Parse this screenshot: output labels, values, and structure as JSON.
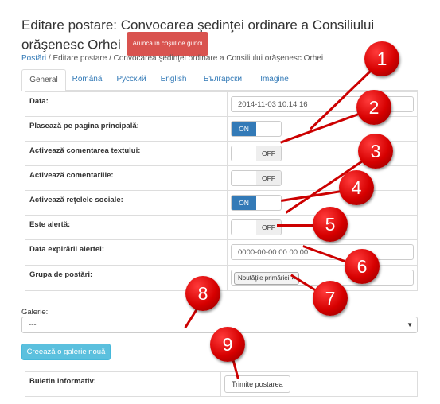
{
  "header": {
    "title": "Editare postare: Convocarea şedinţei ordinare a Consiliului orăşenesc Orhei",
    "trash_button": "Aruncă în coşul de gunoi"
  },
  "breadcrumb": {
    "root": "Postări",
    "separator": " / ",
    "edit": "Editare postare",
    "current": "Convocarea şedinţei ordinare a Consiliului orăşenesc Orhei"
  },
  "tabs": [
    "General",
    "Română",
    "Русский",
    "English",
    "Български",
    "Imagine"
  ],
  "active_tab": "General",
  "form": {
    "date_label": "Data:",
    "date_value": "2014-11-03 10:14:16",
    "main_page_label": "Plasează pe pagina principală:",
    "main_page_value": "ON",
    "comment_text_label": "Activează comentarea textului:",
    "comment_text_value": "OFF",
    "comments_label": "Activează comentariile:",
    "comments_value": "OFF",
    "social_label": "Activează reţelele sociale:",
    "social_value": "ON",
    "alert_label": "Este alertă:",
    "alert_value": "OFF",
    "alert_expiry_label": "Data expirării alertei:",
    "alert_expiry_value": "0000-00-00 00:00:00",
    "group_label": "Grupa de postări:",
    "group_tag": "Noutăţile primăriei",
    "tag_remove": "×"
  },
  "gallery": {
    "label": "Galerie:",
    "selected": "---",
    "new_button": "Creează o galerie nouă"
  },
  "newsletter": {
    "label": "Buletin informativ:",
    "button": "Trimite postarea"
  },
  "callouts": [
    "1",
    "2",
    "3",
    "4",
    "5",
    "6",
    "7",
    "8",
    "9"
  ],
  "colors": {
    "accent": "#337ab7",
    "danger": "#d9534f",
    "info": "#5bc0de",
    "callout": "#d60000"
  }
}
